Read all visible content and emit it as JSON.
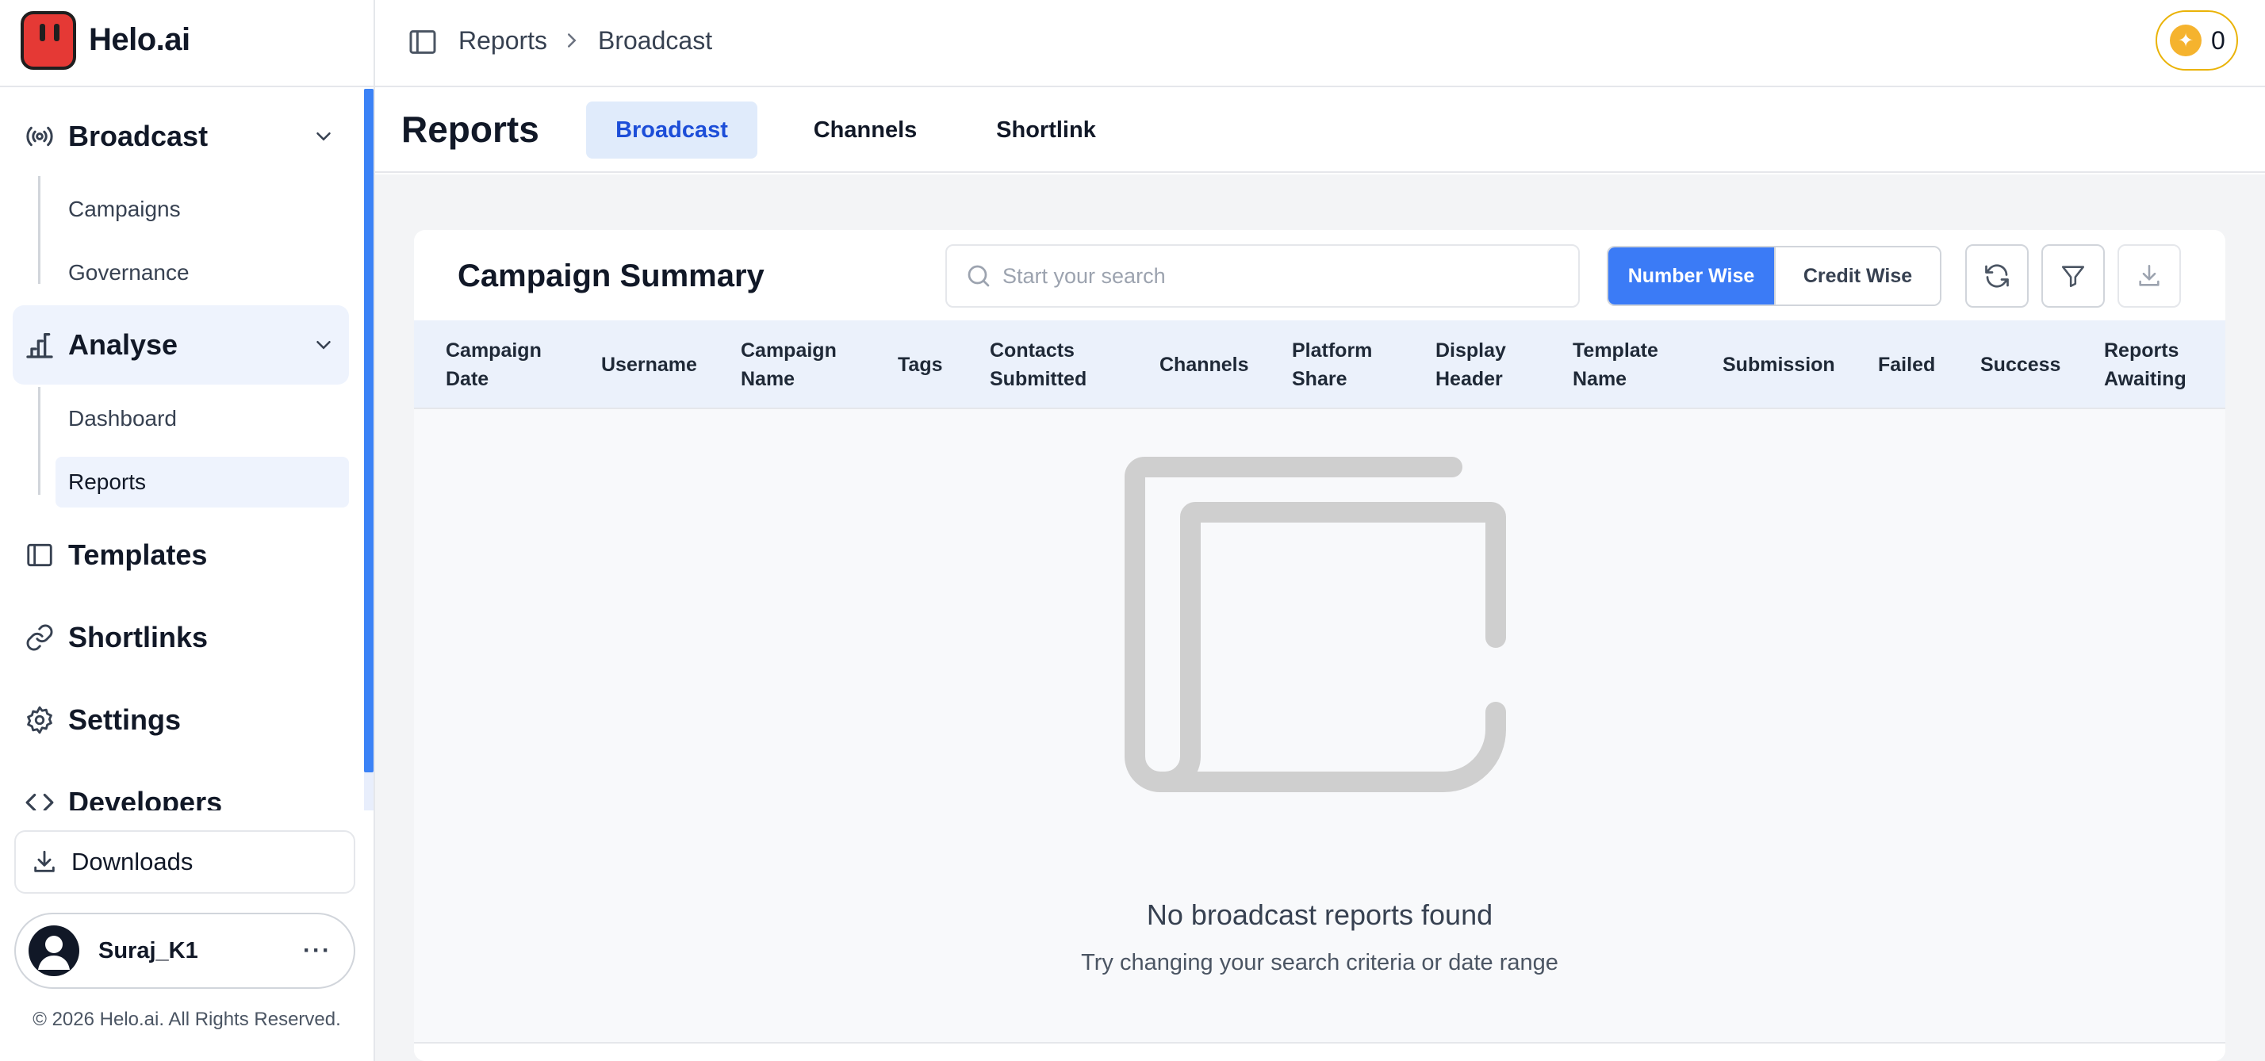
{
  "brand": {
    "name": "Helo.ai",
    "logo_icon": "helo-logo-icon",
    "logo_color": "#e53935"
  },
  "sidebar": {
    "sections": [
      {
        "label": "Broadcast",
        "icon": "broadcast-icon",
        "expanded": true,
        "items": [
          "Campaigns",
          "Governance"
        ]
      },
      {
        "label": "Analyse",
        "icon": "bar-chart-icon",
        "expanded": true,
        "active": true,
        "items": [
          "Dashboard",
          "Reports"
        ],
        "active_item": "Reports"
      },
      {
        "label": "Templates",
        "icon": "sidebar-panel-icon"
      },
      {
        "label": "Shortlinks",
        "icon": "link-icon"
      },
      {
        "label": "Settings",
        "icon": "gear-icon"
      },
      {
        "label": "Developers",
        "icon": "code-icon"
      }
    ],
    "downloads_label": "Downloads",
    "user": {
      "name": "Suraj_K1",
      "more": "···"
    },
    "copyright": "© 2026 Helo.ai. All Rights Reserved."
  },
  "topbar": {
    "breadcrumb": [
      "Reports",
      "Broadcast"
    ],
    "credits": "0",
    "credit_color": "#eab308"
  },
  "reports": {
    "title": "Reports",
    "tabs": [
      {
        "label": "Broadcast",
        "active": true
      },
      {
        "label": "Channels",
        "active": false
      },
      {
        "label": "Shortlink",
        "active": false
      }
    ]
  },
  "campaign_summary": {
    "title": "Campaign Summary",
    "search_placeholder": "Start your search",
    "view_toggle": [
      "Number Wise",
      "Credit Wise"
    ],
    "view_selected": "Number Wise",
    "actions": [
      "refresh-icon",
      "filter-icon",
      "download-icon"
    ],
    "columns": [
      "Campaign Date",
      "Username",
      "Campaign Name",
      "Tags",
      "Contacts Submitted",
      "Channels",
      "Platform Share",
      "Display Header",
      "Template Name",
      "Submission",
      "Failed",
      "Success",
      "Reports Awaiting"
    ],
    "empty_title": "No broadcast reports found",
    "empty_subtitle": "Try changing your search criteria or date range"
  },
  "colors": {
    "accent": "#3b7bf6",
    "active_tab_bg": "#e0ebfb",
    "active_tab_text": "#1d4ed8",
    "table_header_bg": "#ebf1fb"
  }
}
